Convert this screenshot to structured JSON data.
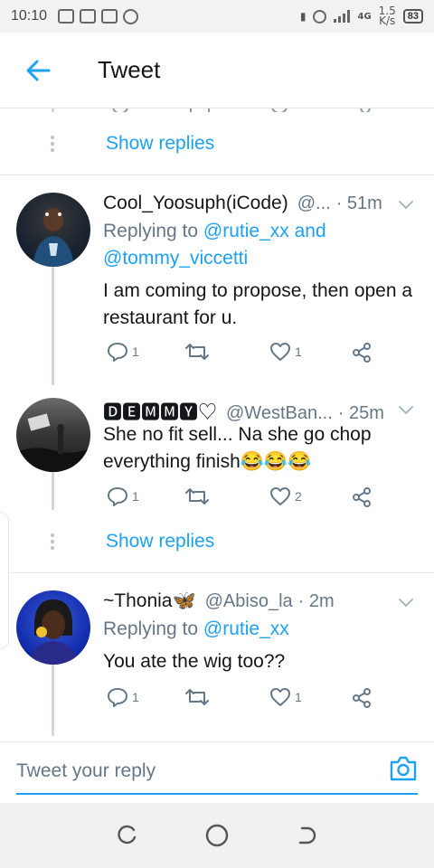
{
  "status_bar": {
    "time": "10:10",
    "network_type": "4G",
    "speed_value": "1.5",
    "speed_unit": "K/s",
    "battery": "83"
  },
  "header": {
    "title": "Tweet"
  },
  "show_replies_label": "Show replies",
  "tweets": [
    {
      "name": "Cool_Yoosuph(iCode)",
      "handle": "@...",
      "time": "· 51m",
      "replying_prefix": "Replying to ",
      "mention_1": "@rutie_xx",
      "replying_and": " and",
      "mention_2": "@tommy_viccetti",
      "text": "I am coming to propose, then open a restaurant for u.",
      "reply_count": "1",
      "retweet_count": "",
      "like_count": "1"
    },
    {
      "name": "🅳🅴🅼🅼🆈♡",
      "handle": "@WestBan...",
      "time": "· 25m",
      "text": "She no fit sell... Na she go chop everything finish😂😂😂",
      "reply_count": "1",
      "retweet_count": "",
      "like_count": "2"
    },
    {
      "name": "~Thonia🦋",
      "handle": "@Abiso_la",
      "time": "· 2m",
      "replying_prefix": "Replying to ",
      "mention_1": "@rutie_xx",
      "text": "You ate the wig too??",
      "reply_count": "1",
      "retweet_count": "",
      "like_count": "1"
    }
  ],
  "reply_bar": {
    "placeholder": "Tweet your reply"
  },
  "colors": {
    "accent": "#1da1f2",
    "secondary_text": "#657786",
    "divider": "#e1e8ed"
  },
  "icons": [
    "back-arrow-icon",
    "chevron-down-icon",
    "reply-icon",
    "retweet-icon",
    "like-icon",
    "share-icon",
    "camera-icon",
    "recents-icon",
    "home-icon",
    "back-icon"
  ]
}
